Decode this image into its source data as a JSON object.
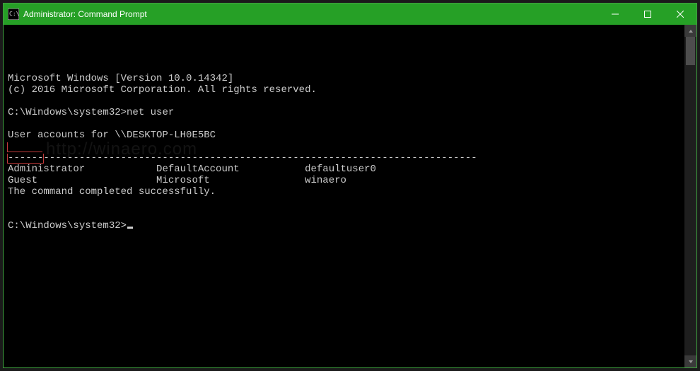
{
  "window": {
    "title": "Administrator: Command Prompt"
  },
  "terminal": {
    "header1": "Microsoft Windows [Version 10.0.14342]",
    "header2": "(c) 2016 Microsoft Corporation. All rights reserved.",
    "prompt1_path": "C:\\Windows\\system32>",
    "prompt1_cmd": "net user",
    "accounts_header": "User accounts for \\\\DESKTOP-LH0E5BC",
    "separator": "-------------------------------------------------------------------------------",
    "row1_col1": "Administrator",
    "row1_col2": "DefaultAccount",
    "row1_col3": "defaultuser0",
    "row2_col1": "Guest",
    "row2_col2": "Microsoft",
    "row2_col3": "winaero",
    "completed": "The command completed successfully.",
    "prompt2_path": "C:\\Windows\\system32>"
  },
  "watermark": "http://winaero.com"
}
